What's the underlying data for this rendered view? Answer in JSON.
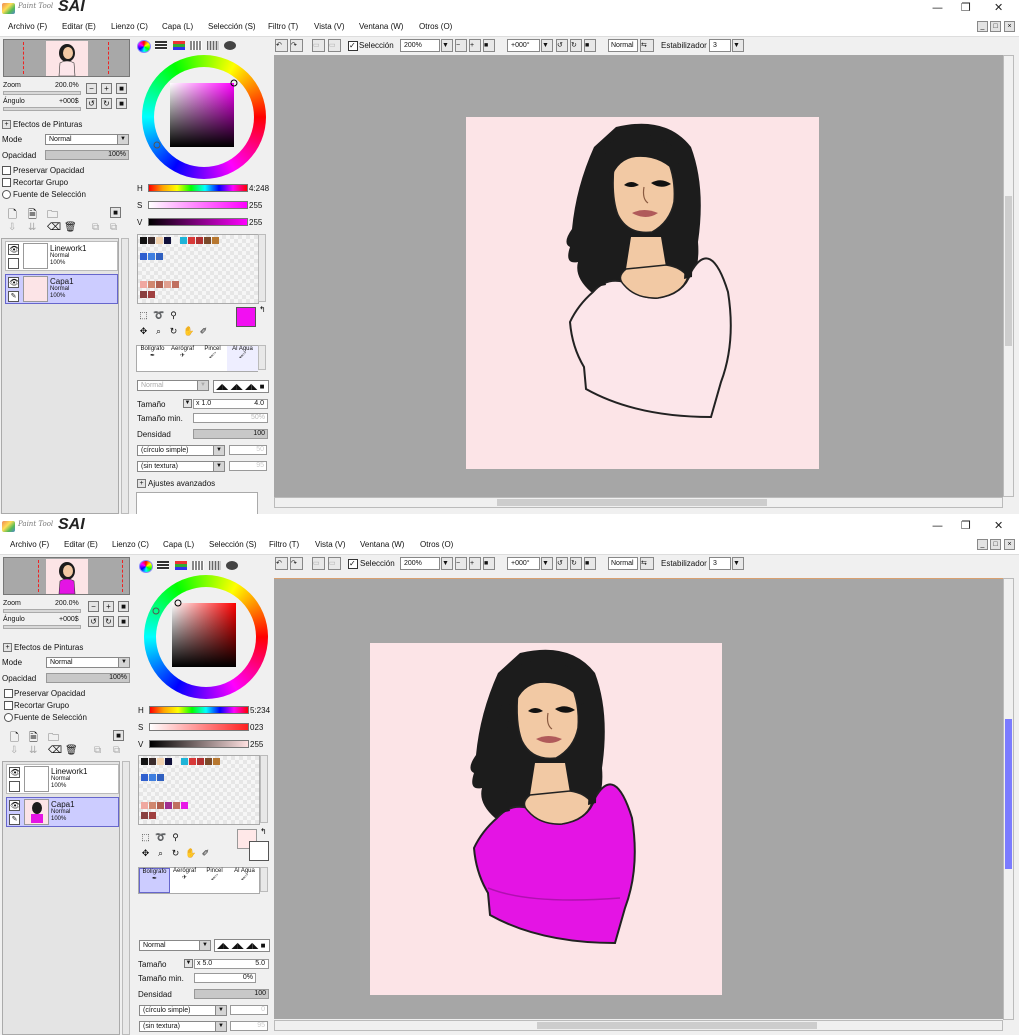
{
  "app": {
    "logo_text": "Paint Tool",
    "logo_sai": "SAI"
  },
  "window_controls": {
    "minimize": "—",
    "restore": "❐",
    "close": "✕"
  },
  "menu": [
    "Archivo (F)",
    "Editar (E)",
    "Lienzo (C)",
    "Capa (L)",
    "Selección (S)",
    "Filtro (T)",
    "Vista (V)",
    "Ventana (W)",
    "Otros (O)"
  ],
  "navigator": {
    "zoom_label": "Zoom",
    "zoom_value": "200.0%",
    "angle_label": "Ángulo",
    "angle_value": "+000$"
  },
  "paint_effects": {
    "title": "Efectos de Pinturas",
    "mode_label": "Mode",
    "mode_value": "Normal",
    "opacity_label": "Opacidad",
    "opacity_value": "100%",
    "checkboxes": [
      "Preservar Opacidad",
      "Recortar Grupo",
      "Fuente de Selección"
    ]
  },
  "layers": [
    {
      "name": "Linework1",
      "mode": "Normal",
      "opacity": "100%"
    },
    {
      "name": "Capa1",
      "mode": "Normal",
      "opacity": "100%"
    }
  ],
  "toolbar": {
    "selection_label": "Selección",
    "zoom": "200%",
    "angle": "+000°",
    "blend": "Normal",
    "stabilizer_label": "Estabilizador",
    "stabilizer_value": "3"
  },
  "brushes": [
    "Bolígrafo",
    "Aerógraf",
    "Pincel",
    "Al Agua"
  ],
  "brush_settings": {
    "size_label": "Tamaño",
    "min_size_label": "Tamaño min.",
    "density_label": "Densidad",
    "density_value": "100",
    "shape": "(círculo simple)",
    "texture": "(sin textura)",
    "advanced": "Ajustes avanzados",
    "blend_mode": "Normal"
  },
  "state1": {
    "hsv": {
      "h_label": "H",
      "h_value": "4:248",
      "s_label": "S",
      "s_value": "255",
      "v_label": "V",
      "v_value": "255"
    },
    "size_mult": "x 1.0",
    "size_value": "4.0",
    "min_size_value": "50%",
    "shape_value": "50",
    "texture_value": "95",
    "main_color": "#f20ff2",
    "square_color": "#ff00ff",
    "shirt_color": "#fce6ea",
    "mode_faded": true
  },
  "state2": {
    "hsv": {
      "h_label": "H",
      "h_value": "5:234",
      "s_label": "S",
      "s_value": "023",
      "v_label": "V",
      "v_value": "255"
    },
    "size_mult": "x 5.0",
    "size_value": "5.0",
    "min_size_value": "0%",
    "shape_value": "0",
    "texture_value": "95",
    "main_color": "#ffe8e8",
    "square_color": "#cc0000",
    "shirt_color": "#e414e4",
    "mode_faded": false
  },
  "palette_colors": [
    "#111111",
    "#3a2b2b",
    "#f1d2b0",
    "#10103a",
    "#1fb4d8",
    "#d83838",
    "#b03030",
    "#7a4a2a",
    "#b87830",
    "#2f5fcf",
    "#3f7fe0",
    "#3060c0",
    "#f0a8a0",
    "#d08870",
    "#b06050",
    "#8a4040"
  ],
  "palette_extra2": [
    "#a03090",
    "#e818e8"
  ],
  "colors": {
    "canvas_bg": "#a6a6a6",
    "page_bg": "#fce4e7",
    "hair": "#1c1c1c",
    "skin": "#f2c9a4",
    "skin_shade": "#d9a27a",
    "lips": "#b05a5a",
    "selected_layer": "#ccccff"
  }
}
